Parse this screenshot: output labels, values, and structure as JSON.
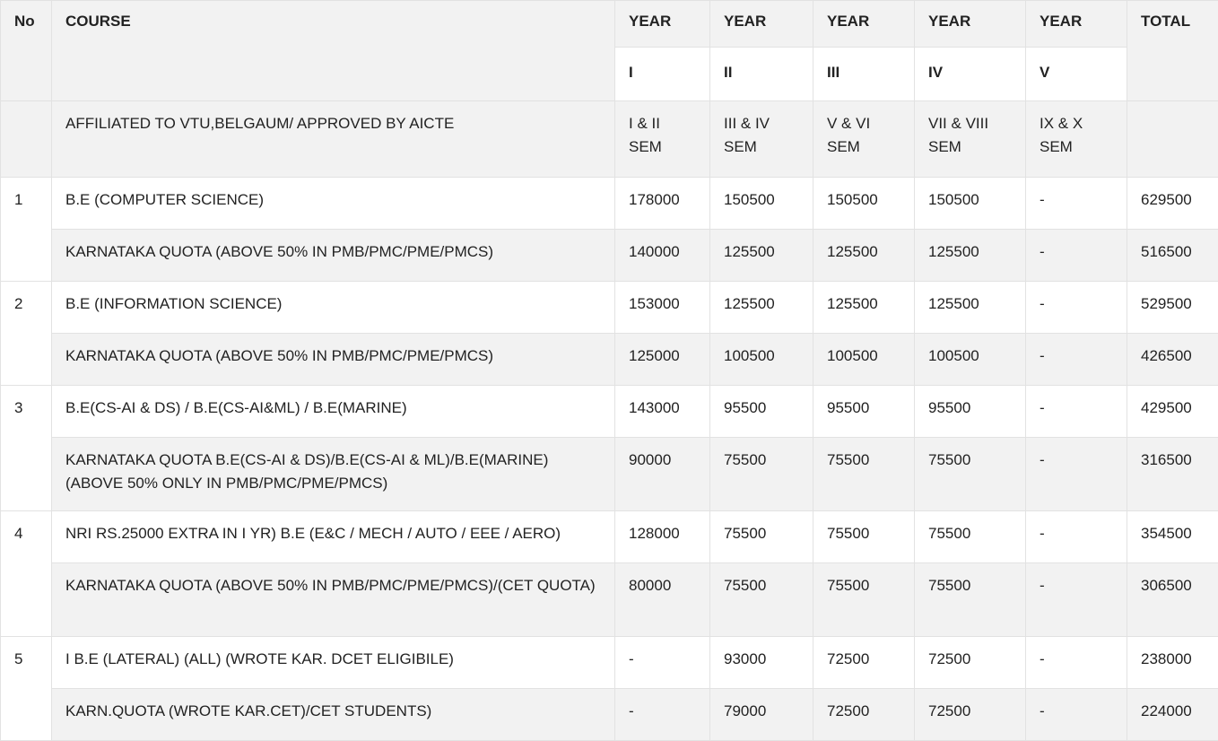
{
  "header": {
    "no": "No",
    "course": "COURSE",
    "year_word": "YEAR",
    "year_numerals": [
      "I",
      "II",
      "III",
      "IV",
      "V"
    ],
    "total": "TOTAL"
  },
  "affiliation": {
    "label": "AFFILIATED TO VTU,BELGAUM/ APPROVED BY AICTE",
    "sems": [
      "I & II SEM",
      "III & IV SEM",
      "V & VI SEM",
      "VII & VIII SEM",
      "IX & X SEM"
    ]
  },
  "rows": [
    {
      "no": "1",
      "course": "B.E (COMPUTER SCIENCE)",
      "y1": "178000",
      "y2": "150500",
      "y3": "150500",
      "y4": "150500",
      "y5": "-",
      "total": "629500"
    },
    {
      "course": "KARNATAKA QUOTA (ABOVE 50% IN PMB/PMC/PME/PMCS)",
      "y1": "140000",
      "y2": "125500",
      "y3": "125500",
      "y4": "125500",
      "y5": "-",
      "total": "516500"
    },
    {
      "no": "2",
      "course": "B.E (INFORMATION SCIENCE)",
      "y1": "153000",
      "y2": "125500",
      "y3": "125500",
      "y4": "125500",
      "y5": "-",
      "total": "529500"
    },
    {
      "course": "KARNATAKA QUOTA (ABOVE 50% IN PMB/PMC/PME/PMCS)",
      "y1": "125000",
      "y2": "100500",
      "y3": "100500",
      "y4": "100500",
      "y5": "-",
      "total": "426500"
    },
    {
      "no": "3",
      "course": "B.E(CS-AI & DS) / B.E(CS-AI&ML) / B.E(MARINE)",
      "y1": "143000",
      "y2": "95500",
      "y3": "95500",
      "y4": "95500",
      "y5": "-",
      "total": "429500"
    },
    {
      "course": "KARNATAKA QUOTA B.E(CS-AI & DS)/B.E(CS-AI & ML)/B.E(MARINE) (ABOVE 50% ONLY IN PMB/PMC/PME/PMCS)",
      "y1": "90000",
      "y2": "75500",
      "y3": "75500",
      "y4": "75500",
      "y5": "-",
      "total": "316500"
    },
    {
      "no": "4",
      "course": "NRI RS.25000 EXTRA IN I YR) B.E (E&C / MECH / AUTO / EEE / AERO)",
      "y1": "128000",
      "y2": "75500",
      "y3": "75500",
      "y4": "75500",
      "y5": "-",
      "total": "354500"
    },
    {
      "course": "KARNATAKA QUOTA (ABOVE 50% IN PMB/PMC/PME/PMCS)/(CET QUOTA)",
      "y1": "80000",
      "y2": "75500",
      "y3": "75500",
      "y4": "75500",
      "y5": "-",
      "total": "306500"
    },
    {
      "no": "5",
      "course": "I B.E (LATERAL) (ALL) (WROTE KAR. DCET ELIGIBILE)",
      "y1": "-",
      "y2": "93000",
      "y3": "72500",
      "y4": "72500",
      "y5": "-",
      "total": "238000"
    },
    {
      "course": "KARN.QUOTA (WROTE KAR.CET)/CET STUDENTS)",
      "y1": "-",
      "y2": "79000",
      "y3": "72500",
      "y4": "72500",
      "y5": "-",
      "total": "224000"
    }
  ]
}
